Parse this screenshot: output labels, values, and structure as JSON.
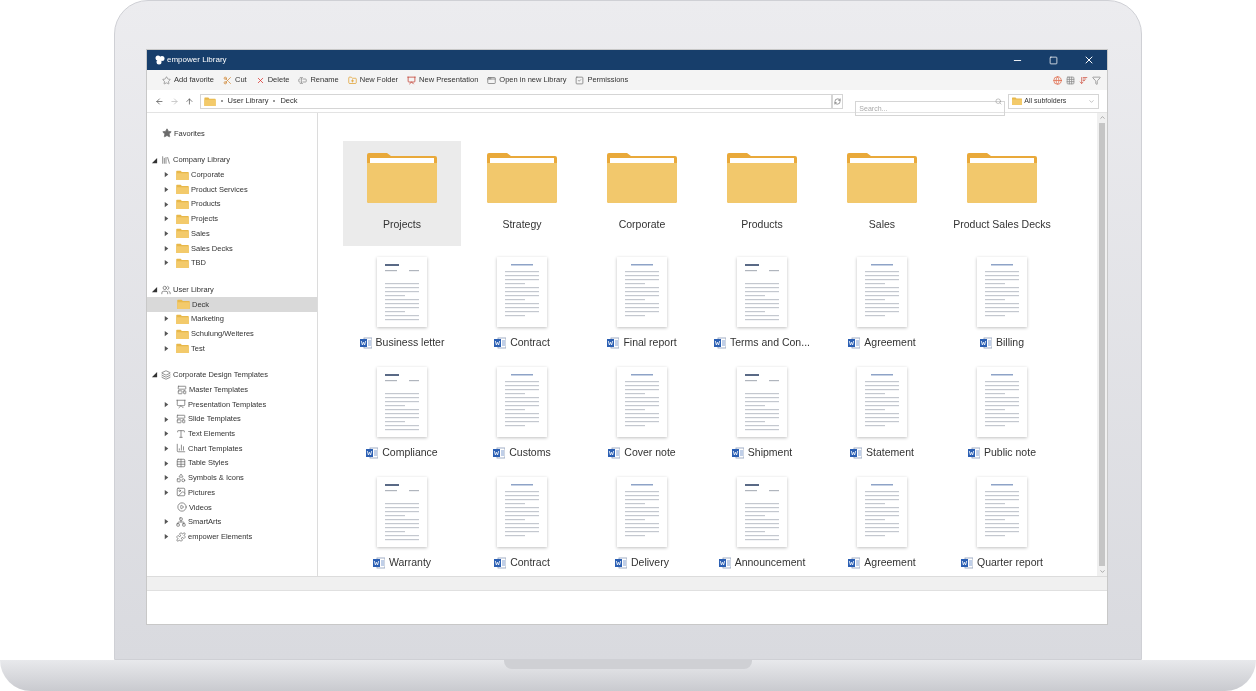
{
  "window": {
    "title": "empower Library"
  },
  "toolbar": [
    {
      "label": "Add favorite"
    },
    {
      "label": "Cut"
    },
    {
      "label": "Delete"
    },
    {
      "label": "Rename"
    },
    {
      "label": "New Folder"
    },
    {
      "label": "New Presentation"
    },
    {
      "label": "Open in new Library"
    },
    {
      "label": "Permissions"
    }
  ],
  "breadcrumbs": [
    "User Library",
    "Deck"
  ],
  "search": {
    "placeholder": "Search..."
  },
  "scope": {
    "value": "All subfolders"
  },
  "tree": [
    {
      "label": "Favorites",
      "kind": "star",
      "selected": false
    },
    {
      "label": "Company Library",
      "kind": "library",
      "expanded": true,
      "selected": false,
      "children": [
        {
          "label": "Corporate",
          "kind": "folder",
          "expanded": false,
          "selected": false
        },
        {
          "label": "Product Services",
          "kind": "folder",
          "expanded": false,
          "selected": false
        },
        {
          "label": "Products",
          "kind": "folder",
          "expanded": false,
          "selected": false
        },
        {
          "label": "Projects",
          "kind": "folder",
          "expanded": false,
          "selected": false
        },
        {
          "label": "Sales",
          "kind": "folder",
          "expanded": false,
          "selected": false
        },
        {
          "label": "Sales Decks",
          "kind": "folder",
          "expanded": false,
          "selected": false
        },
        {
          "label": "TBD",
          "kind": "folder",
          "expanded": false,
          "selected": false
        }
      ]
    },
    {
      "label": "User Library",
      "kind": "users",
      "expanded": true,
      "selected": false,
      "children": [
        {
          "label": "Deck",
          "kind": "folder",
          "selected": true
        },
        {
          "label": "Marketing",
          "kind": "folder",
          "expanded": false,
          "selected": false
        },
        {
          "label": "Schulung/Weiteres",
          "kind": "folder",
          "expanded": false,
          "selected": false
        },
        {
          "label": "Test",
          "kind": "folder",
          "expanded": false,
          "selected": false
        }
      ]
    },
    {
      "label": "Corporate Design Templates",
      "kind": "templates",
      "expanded": true,
      "selected": false,
      "children": [
        {
          "label": "Master Templates",
          "kind": "master",
          "selected": false
        },
        {
          "label": "Presentation Templates",
          "kind": "presentation",
          "expanded": false,
          "selected": false
        },
        {
          "label": "Slide Templates",
          "kind": "slide",
          "expanded": false,
          "selected": false
        },
        {
          "label": "Text Elements",
          "kind": "text",
          "expanded": false,
          "selected": false
        },
        {
          "label": "Chart Templates",
          "kind": "chart",
          "expanded": false,
          "selected": false
        },
        {
          "label": "Table Styles",
          "kind": "table",
          "expanded": false,
          "selected": false
        },
        {
          "label": "Symbols & Icons",
          "kind": "symbols",
          "expanded": false,
          "selected": false
        },
        {
          "label": "Pictures",
          "kind": "pictures",
          "expanded": false,
          "selected": false
        },
        {
          "label": "Videos",
          "kind": "videos",
          "selected": false
        },
        {
          "label": "SmartArts",
          "kind": "smartart",
          "expanded": false,
          "selected": false
        },
        {
          "label": "empower Elements",
          "kind": "elements",
          "expanded": false,
          "selected": false
        }
      ]
    }
  ],
  "items": [
    {
      "label": "Projects",
      "kind": "folder",
      "selected": true
    },
    {
      "label": "Strategy",
      "kind": "folder",
      "selected": false
    },
    {
      "label": "Corporate",
      "kind": "folder",
      "selected": false
    },
    {
      "label": "Products",
      "kind": "folder",
      "selected": false
    },
    {
      "label": "Sales",
      "kind": "folder",
      "selected": false
    },
    {
      "label": "Product Sales Decks",
      "kind": "folder",
      "selected": false
    },
    {
      "label": "Business letter",
      "kind": "document",
      "selected": false
    },
    {
      "label": "Contract",
      "kind": "document",
      "selected": false
    },
    {
      "label": "Final report",
      "kind": "document",
      "selected": false
    },
    {
      "label": "Terms and Con...",
      "kind": "document",
      "selected": false
    },
    {
      "label": "Agreement",
      "kind": "document",
      "selected": false
    },
    {
      "label": "Billing",
      "kind": "document",
      "selected": false
    },
    {
      "label": "Compliance",
      "kind": "document",
      "selected": false
    },
    {
      "label": "Customs",
      "kind": "document",
      "selected": false
    },
    {
      "label": "Cover note",
      "kind": "document",
      "selected": false
    },
    {
      "label": "Shipment",
      "kind": "document",
      "selected": false
    },
    {
      "label": "Statement",
      "kind": "document",
      "selected": false
    },
    {
      "label": "Public note",
      "kind": "document",
      "selected": false
    },
    {
      "label": "Warranty",
      "kind": "document",
      "selected": false
    },
    {
      "label": "Contract",
      "kind": "document",
      "selected": false
    },
    {
      "label": "Delivery",
      "kind": "document",
      "selected": false
    },
    {
      "label": "Announcement",
      "kind": "document",
      "selected": false
    },
    {
      "label": "Agreement",
      "kind": "document",
      "selected": false
    },
    {
      "label": "Quarter report",
      "kind": "document",
      "selected": false
    }
  ]
}
